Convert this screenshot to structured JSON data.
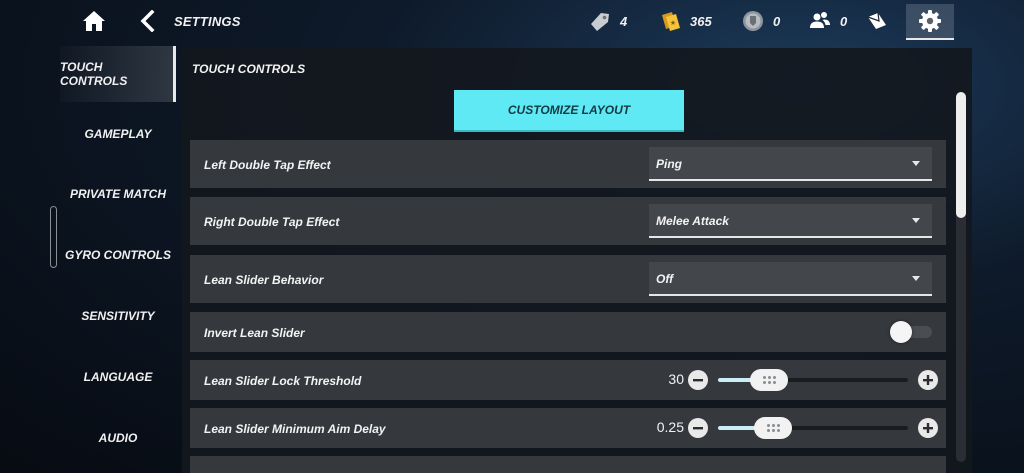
{
  "header": {
    "title": "SETTINGS",
    "currencies": [
      {
        "icon": "tag-icon",
        "value": "4"
      },
      {
        "icon": "gold-tickets-icon",
        "value": "365"
      },
      {
        "icon": "medal-icon",
        "value": "0"
      },
      {
        "icon": "friends-icon",
        "value": "0"
      }
    ]
  },
  "sidebar": {
    "items": [
      {
        "label": "TOUCH CONTROLS",
        "active": true
      },
      {
        "label": "GAMEPLAY"
      },
      {
        "label": "PRIVATE MATCH"
      },
      {
        "label": "GYRO CONTROLS"
      },
      {
        "label": "SENSITIVITY"
      },
      {
        "label": "LANGUAGE"
      },
      {
        "label": "AUDIO"
      }
    ]
  },
  "panel": {
    "section_title": "TOUCH CONTROLS",
    "customize_label": "CUSTOMIZE LAYOUT",
    "rows": [
      {
        "label": "Left Double Tap Effect",
        "type": "dropdown",
        "value": "Ping"
      },
      {
        "label": "Right Double Tap Effect",
        "type": "dropdown",
        "value": "Melee Attack"
      },
      {
        "label": "Lean Slider Behavior",
        "type": "dropdown",
        "value": "Off"
      },
      {
        "label": "Invert Lean Slider",
        "type": "toggle",
        "value": false
      },
      {
        "label": "Lean Slider Lock Threshold",
        "type": "slider",
        "value": "30",
        "level": 0.27
      },
      {
        "label": "Lean Slider Minimum Aim Delay",
        "type": "slider",
        "value": "0.25",
        "level": 0.29
      }
    ],
    "scroll_position": 0.0
  },
  "colors": {
    "accent_cyan": "#5ee9f5",
    "row_bg": "#35383d",
    "panel_bg": "#14181e"
  }
}
